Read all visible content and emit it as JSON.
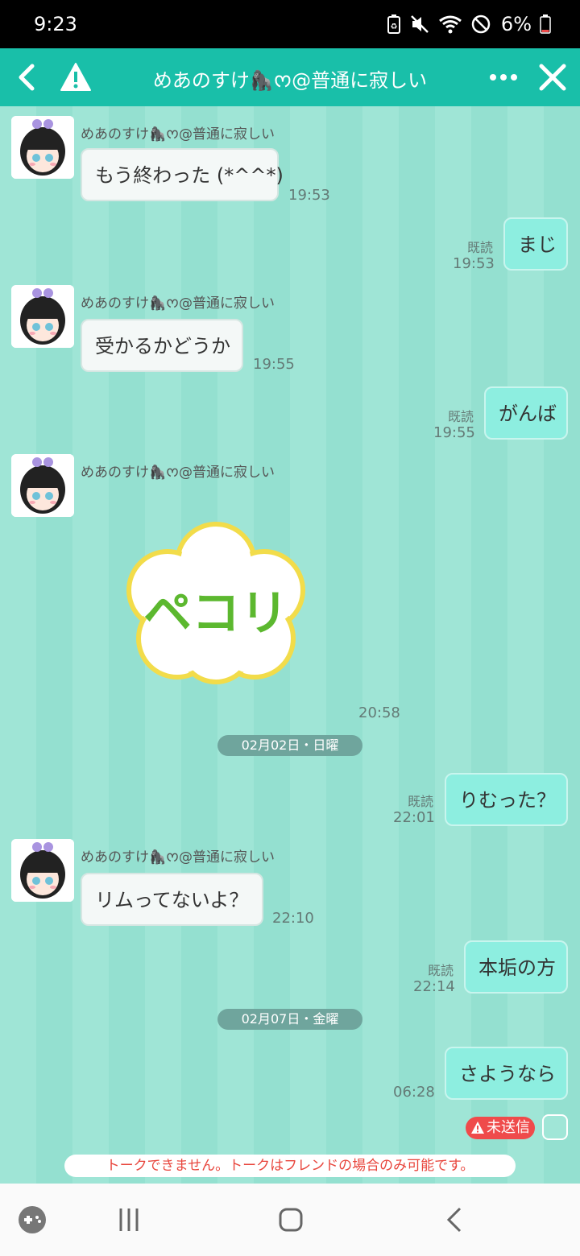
{
  "status_bar": {
    "time": "9:23",
    "battery": "6%"
  },
  "header": {
    "title": "めあのすけ🦍ᰔ@普通に寂しい"
  },
  "messages": [
    {
      "sender": "めあのすけ🦍ᰔ@普通に寂しい",
      "text": "もう終わった (*^^*)",
      "time": "19:53"
    },
    {
      "read": "既読",
      "text": "まじ",
      "time": "19:53"
    },
    {
      "sender": "めあのすけ🦍ᰔ@普通に寂しい",
      "text": "受かるかどうか",
      "time": "19:55"
    },
    {
      "read": "既読",
      "text": "がんば",
      "time": "19:55"
    },
    {
      "sender": "めあのすけ🦍ᰔ@普通に寂しい",
      "sticker_text": "ペコリ",
      "time": "20:58"
    },
    {
      "read": "既読",
      "text": "りむった？",
      "time": "22:01"
    },
    {
      "sender": "めあのすけ🦍ᰔ@普通に寂しい",
      "text": "リムってないよ？",
      "time": "22:10"
    },
    {
      "read": "既読",
      "text": "本垢の方",
      "time": "22:14"
    },
    {
      "text": "さようなら",
      "time": "06:28"
    }
  ],
  "date_separators": [
    "02月02日・日曜",
    "02月07日・金曜"
  ],
  "unsent_label": "未送信",
  "notice": "トークできません。トークはフレンドの場合のみ可能です。",
  "colors": {
    "header": "#19bfa9",
    "background": "#9fe5d6",
    "unsent": "#ef4b4b"
  }
}
